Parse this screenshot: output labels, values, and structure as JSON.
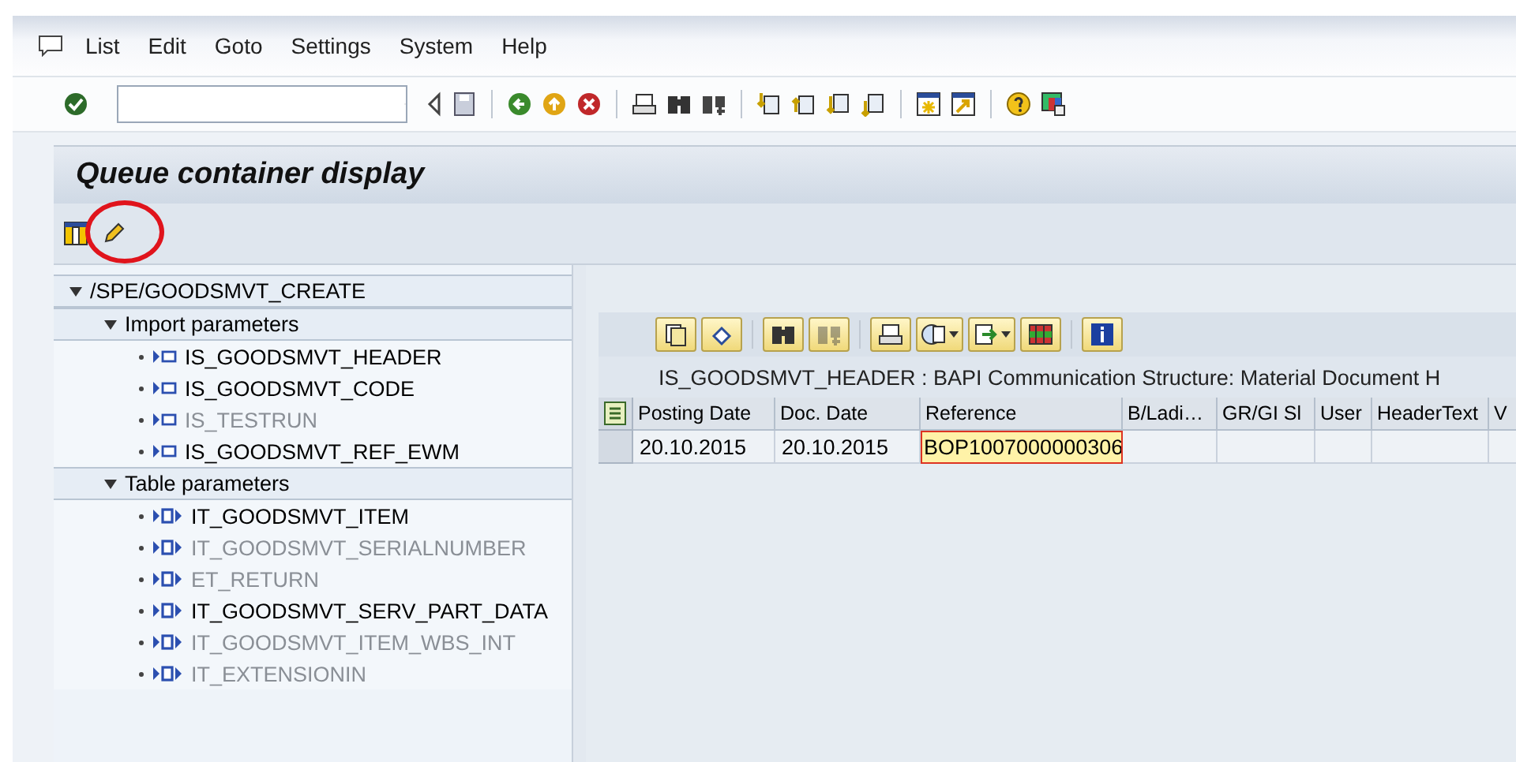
{
  "menu": [
    "List",
    "Edit",
    "Goto",
    "Settings",
    "System",
    "Help"
  ],
  "screen_title": "Queue container display",
  "tree": {
    "label": "/SPE/GOODSMVT_CREATE",
    "expanded": true,
    "children": [
      {
        "label": "Import parameters",
        "expanded": true,
        "children": [
          {
            "label": "IS_GOODSMVT_HEADER",
            "kind": "structure",
            "disabled": false
          },
          {
            "label": "IS_GOODSMVT_CODE",
            "kind": "structure",
            "disabled": false
          },
          {
            "label": "IS_TESTRUN",
            "kind": "structure",
            "disabled": true
          },
          {
            "label": "IS_GOODSMVT_REF_EWM",
            "kind": "structure",
            "disabled": false
          }
        ]
      },
      {
        "label": "Table parameters",
        "expanded": true,
        "children": [
          {
            "label": "IT_GOODSMVT_ITEM",
            "kind": "table",
            "disabled": false
          },
          {
            "label": "IT_GOODSMVT_SERIALNUMBER",
            "kind": "table",
            "disabled": true
          },
          {
            "label": "ET_RETURN",
            "kind": "table",
            "disabled": true
          },
          {
            "label": "IT_GOODSMVT_SERV_PART_DATA",
            "kind": "table",
            "disabled": false
          },
          {
            "label": "IT_GOODSMVT_ITEM_WBS_INT",
            "kind": "table",
            "disabled": true
          },
          {
            "label": "IT_EXTENSIONIN",
            "kind": "table",
            "disabled": true
          }
        ]
      }
    ]
  },
  "grid": {
    "title": "IS_GOODSMVT_HEADER : BAPI Communication Structure: Material Document H",
    "columns": [
      "Posting Date",
      "Doc. Date",
      "Reference",
      "B/Ladi…",
      "GR/GI Sl",
      "User",
      "HeaderText",
      "V"
    ],
    "rows": [
      {
        "cells": [
          {
            "text": "20.10.2015",
            "selected": false
          },
          {
            "text": "20.10.2015",
            "selected": false
          },
          {
            "text": "BOP1007000000306",
            "selected": true
          }
        ]
      }
    ]
  }
}
